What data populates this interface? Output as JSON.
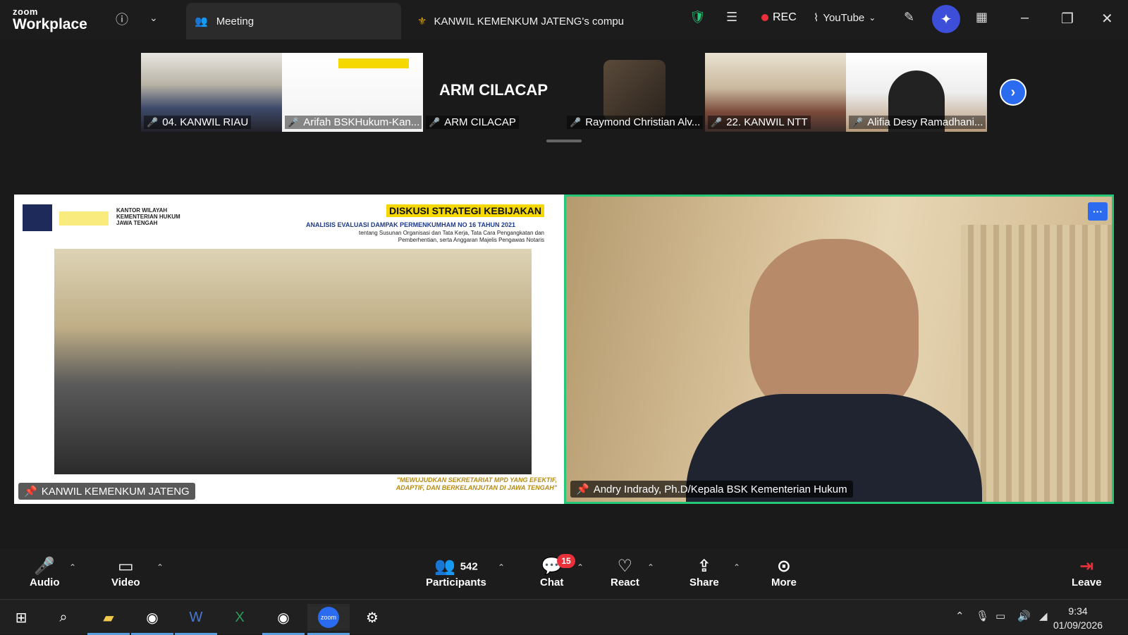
{
  "app": {
    "logo_small": "zoom",
    "logo_big": "Workplace"
  },
  "tabs": [
    {
      "label": "Meeting"
    },
    {
      "label": "KANWIL KEMENKUM JATENG's compu"
    }
  ],
  "status": {
    "rec_label": "REC",
    "stream_label": "YouTube"
  },
  "thumbnails": [
    {
      "name": "04. KANWIL RIAU"
    },
    {
      "name": "Arifah BSKHukum-Kan..."
    },
    {
      "name": "ARM CILACAP",
      "big_label": "ARM CILACAP"
    },
    {
      "name": "Raymond Christian Alv..."
    },
    {
      "name": "22. KANWIL NTT"
    },
    {
      "name": "Alifia Desy Ramadhani..."
    }
  ],
  "share_tile": {
    "label": "KANWIL KEMENKUM JATENG",
    "slide": {
      "kanwil_line1": "KANTOR WILAYAH",
      "kanwil_line2": "KEMENTERIAN HUKUM",
      "kanwil_line3": "JAWA TENGAH",
      "title": "DISKUSI STRATEGI KEBIJAKAN",
      "subtitle": "ANALISIS EVALUASI DAMPAK PERMENKUMHAM NO 16 TAHUN 2021",
      "subtitle2_line1": "tentang Susunan Organisasi dan Tata Kerja, Tata Cara Pengangkatan dan",
      "subtitle2_line2": "Pemberhentian, serta Anggaran Majelis Pengawas Notaris",
      "quote_line1": "\"MEWUJUDKAN SEKRETARIAT MPD YANG EFEKTIF,",
      "quote_line2": "ADAPTIF, DAN BERKELANJUTAN DI JAWA TENGAH\""
    }
  },
  "speaker_tile": {
    "label": "Andry Indrady, Ph.D/Kepala BSK Kementerian Hukum"
  },
  "toolbar": {
    "audio": "Audio",
    "video": "Video",
    "participants": "Participants",
    "participants_count": "542",
    "chat": "Chat",
    "chat_badge": "15",
    "react": "React",
    "share": "Share",
    "more": "More",
    "leave": "Leave"
  },
  "taskbar": {
    "time": "9:34",
    "date": "01/09/2026"
  },
  "colors": {
    "active_speaker": "#27c77a",
    "accent": "#2a6bf0",
    "rec": "#e8303a"
  }
}
